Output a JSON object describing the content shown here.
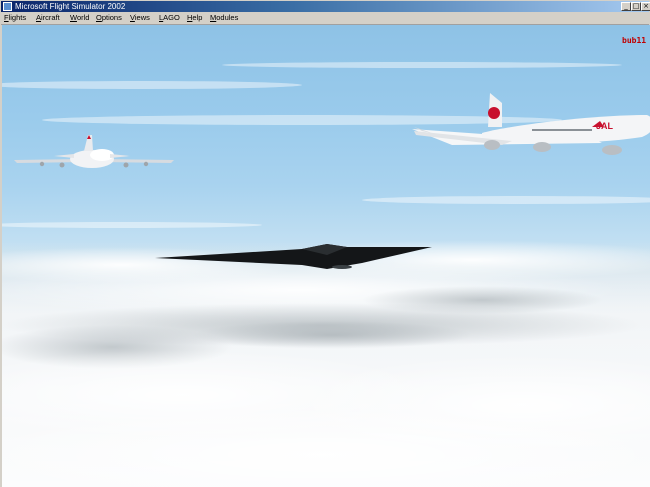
{
  "window": {
    "title": "Microsoft Flight Simulator 2002",
    "controls": {
      "minimize": "_",
      "maximize": "□",
      "close": "×"
    }
  },
  "menubar": {
    "items": [
      {
        "label": "Flights"
      },
      {
        "label": "Aircraft"
      },
      {
        "label": "World"
      },
      {
        "label": "Options"
      },
      {
        "label": "Views"
      },
      {
        "label": "LAGO"
      },
      {
        "label": "Help"
      },
      {
        "label": "Modules"
      }
    ]
  },
  "scene": {
    "watermark": "bub11",
    "airliner_right_livery": "JAL",
    "colors": {
      "sky_top": "#8ec2e6",
      "cloud": "#f4f6f8",
      "bomber": "#141618",
      "airliner_body": "#f2f3f5",
      "jal_red": "#c8102e"
    }
  }
}
